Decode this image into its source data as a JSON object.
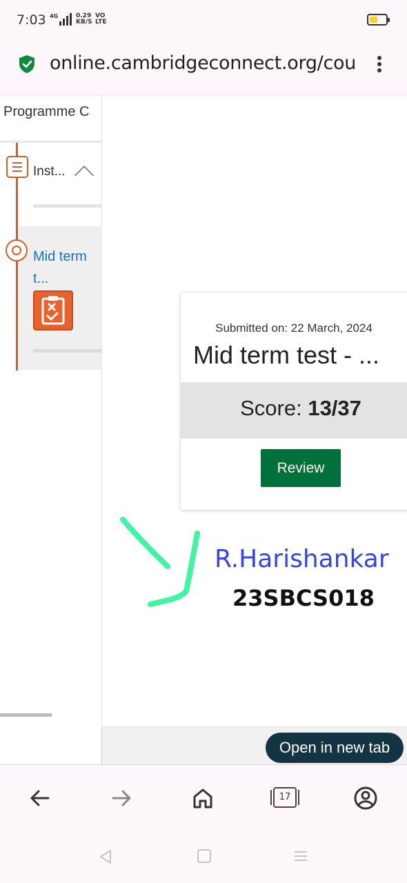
{
  "status_bar": {
    "time": "7:03",
    "network": "4G",
    "speed_value": "0.29",
    "speed_unit": "KB/S",
    "volte_top": "VO",
    "volte_bottom": "LTE"
  },
  "browser": {
    "url": "online.cambridgeconnect.org/cou",
    "tab_count": "17"
  },
  "sidebar": {
    "title": "Programme C",
    "items": [
      {
        "label": "Inst...",
        "icon": "list-icon",
        "expanded": true
      },
      {
        "label": "Mid term t...",
        "icon": "radio-circle-icon",
        "active": true,
        "badge_icon": "clipboard-check-icon"
      }
    ]
  },
  "result": {
    "submitted_label": "Submitted on: 22 March, 2024",
    "test_title": "Mid term test - ...",
    "score_label": "Score:",
    "score_value": "13/37",
    "review_label": "Review"
  },
  "annotation": {
    "name": "R.Harishankar",
    "student_id": "23SBCS018",
    "ink_color": "#3ff5a1",
    "name_color": "#3a43e6"
  },
  "footer": {
    "open_tab_label": "Open in new tab"
  },
  "colors": {
    "accent_orange": "#d0602a",
    "review_green": "#00703c",
    "link_blue": "#1a6fc1",
    "pill_dark": "#143443"
  }
}
